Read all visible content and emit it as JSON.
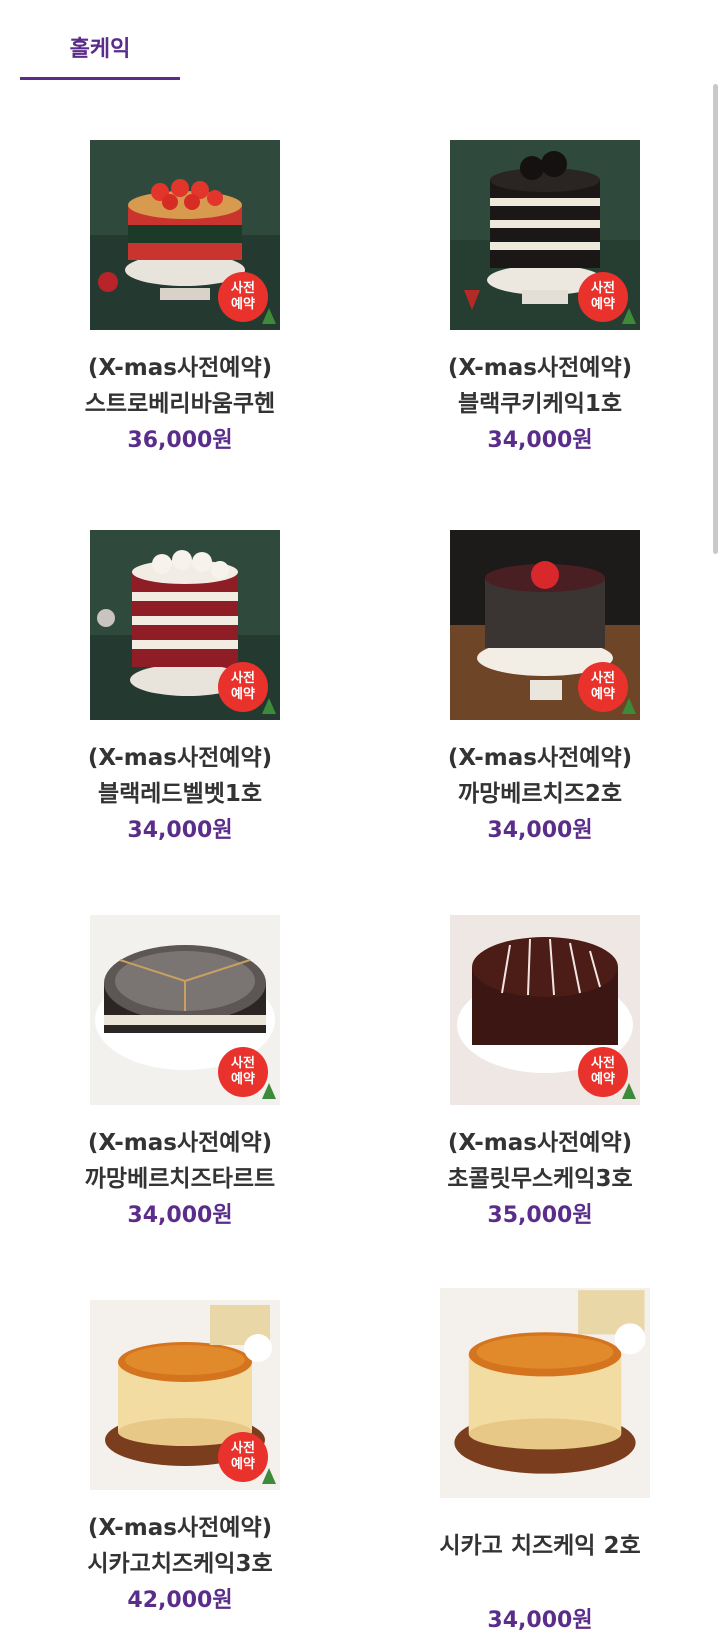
{
  "tabs": [
    {
      "label": "홀케익",
      "active": true
    }
  ],
  "products": [
    {
      "line1": "(X-mas사전예약)",
      "line2": "스트로베리바움쿠헨",
      "price": "36,000원",
      "badge": [
        "사전",
        "예약"
      ]
    },
    {
      "line1": "(X-mas사전예약)",
      "line2": "블랙쿠키케익1호",
      "price": "34,000원",
      "badge": [
        "사전",
        "예약"
      ]
    },
    {
      "line1": "(X-mas사전예약)",
      "line2": "블랙레드벨벳1호",
      "price": "34,000원",
      "badge": [
        "사전",
        "예약"
      ]
    },
    {
      "line1": "(X-mas사전예약)",
      "line2": "까망베르치즈2호",
      "price": "34,000원",
      "badge": [
        "사전",
        "예약"
      ]
    },
    {
      "line1": "(X-mas사전예약)",
      "line2": "까망베르치즈타르트",
      "price": "34,000원",
      "badge": [
        "사전",
        "예약"
      ]
    },
    {
      "line1": "(X-mas사전예약)",
      "line2": "초콜릿무스케익3호",
      "price": "35,000원",
      "badge": [
        "사전",
        "예약"
      ]
    },
    {
      "line1": "(X-mas사전예약)",
      "line2": "시카고치즈케익3호",
      "price": "42,000원",
      "badge": [
        "사전",
        "예약"
      ]
    },
    {
      "line1": "시카고 치즈케익 2호",
      "price": "34,000원"
    }
  ],
  "colors": {
    "accent": "#5b2d8a",
    "badge": "#e8322b",
    "price": "#5b2d8a"
  }
}
